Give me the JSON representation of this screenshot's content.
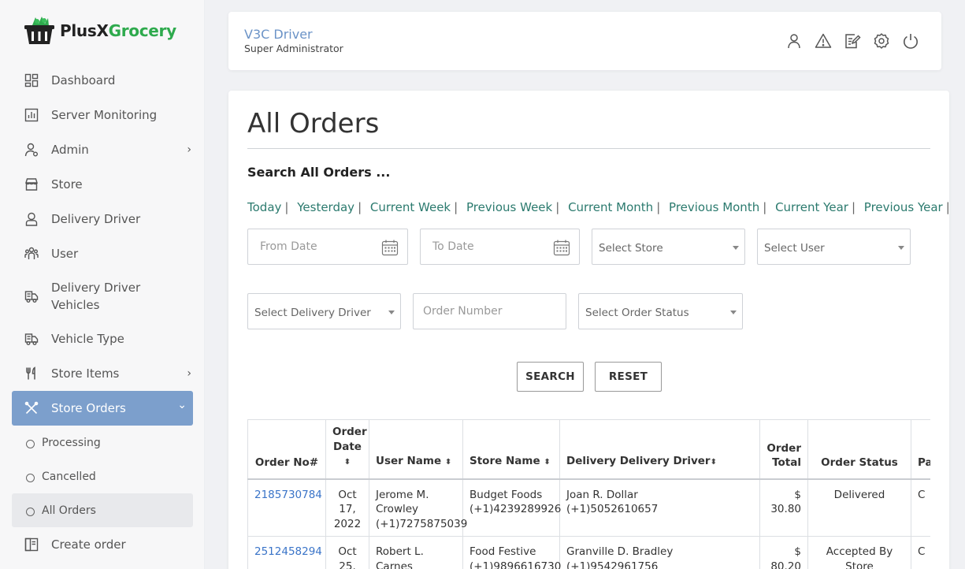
{
  "brand": {
    "name_part1": "PlusX",
    "name_part2": "Grocery"
  },
  "sidebar": {
    "items": [
      {
        "label": "Dashboard",
        "icon": "dashboard-icon",
        "has_arrow": false
      },
      {
        "label": "Server Monitoring",
        "icon": "chart-icon",
        "has_arrow": false
      },
      {
        "label": "Admin",
        "icon": "admin-icon",
        "has_arrow": true
      },
      {
        "label": "Store",
        "icon": "store-icon",
        "has_arrow": false
      },
      {
        "label": "Delivery Driver",
        "icon": "driver-icon",
        "has_arrow": false
      },
      {
        "label": "User",
        "icon": "users-icon",
        "has_arrow": false
      },
      {
        "label": "Delivery Driver Vehicles",
        "icon": "truck-icon",
        "has_arrow": false
      },
      {
        "label": "Vehicle Type",
        "icon": "truck-icon",
        "has_arrow": false
      },
      {
        "label": "Store Items",
        "icon": "fork-icon",
        "has_arrow": true
      },
      {
        "label": "Store Orders",
        "icon": "orders-icon",
        "has_arrow": true,
        "active": true
      }
    ],
    "submenu": [
      {
        "label": "Processing"
      },
      {
        "label": "Cancelled"
      },
      {
        "label": "All Orders",
        "current": true
      }
    ],
    "after_submenu": [
      {
        "label": "Create order",
        "icon": "create-order-icon"
      }
    ],
    "arrow_right": "›",
    "arrow_down": "⌄"
  },
  "header": {
    "user_name": "V3C Driver",
    "user_role": "Super Administrator",
    "icons": [
      "profile-icon",
      "warning-icon",
      "edit-icon",
      "settings-icon",
      "power-icon"
    ]
  },
  "page": {
    "title": "All Orders",
    "search_heading": "Search All Orders ...",
    "quick_filters": [
      "Today",
      "Yesterday",
      "Current Week",
      "Previous Week",
      "Current Month",
      "Previous Month",
      "Current Year",
      "Previous Year"
    ],
    "separator": "|",
    "filters": {
      "from_date": "From Date",
      "to_date": "To Date",
      "select_store": "Select Store",
      "select_user": "Select User",
      "select_driver": "Select Delivery Driver",
      "order_number": "Order Number",
      "select_status": "Select Order Status"
    },
    "buttons": {
      "search": "SEARCH",
      "reset": "RESET"
    }
  },
  "table": {
    "columns": [
      "Order No#",
      "Order Date",
      "User Name",
      "Store Name",
      "Delivery Delivery Driver",
      "Order Total",
      "Order Status",
      "Pa N"
    ],
    "sort_glyph": "⬍",
    "rows": [
      {
        "order_no": "2185730784",
        "date": "Oct 17, 2022",
        "user_name": "Jerome M. Crowley",
        "user_phone": "(+1)7275875039",
        "store_name": "Budget Foods",
        "store_phone": "(+1)4239289926",
        "driver_name": "Joan R. Dollar",
        "driver_phone": "(+1)5052610657",
        "total_currency": "$",
        "total": "30.80",
        "status": "Delivered",
        "payment": "C"
      },
      {
        "order_no": "2512458294",
        "date": "Oct 25,",
        "user_name": "Robert L. Carnes",
        "user_phone": "",
        "store_name": "Food Festive",
        "store_phone": "(+1)9896616730",
        "driver_name": "Granville D. Bradley",
        "driver_phone": "(+1)9542961756",
        "total_currency": "$",
        "total": "80.20",
        "status": "Accepted By Store",
        "payment": "C"
      }
    ]
  }
}
